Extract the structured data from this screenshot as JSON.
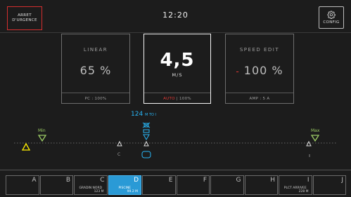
{
  "header": {
    "estop_line1": "ARRET",
    "estop_line2": "D'URGENCE",
    "clock": "12:20",
    "config_label": "CONFIG"
  },
  "cards": {
    "linear": {
      "title": "LINEAR",
      "value": "65 %",
      "footer": "PC : 100%"
    },
    "speed": {
      "value": "4,5",
      "unit": "M/S",
      "footer_mode": "AUTO",
      "footer_rest": " | 100%"
    },
    "speed_edit": {
      "title": "SPEED EDIT",
      "prefix": "-",
      "value": "100 %",
      "footer": "AMP : 5 A"
    }
  },
  "track": {
    "position_label": "124",
    "position_suffix": "M TO I",
    "min_label": "Min",
    "max_label": "Max",
    "current_marker_label": "C",
    "current_station": "D",
    "right_marker": "I"
  },
  "stations": [
    {
      "letter": "A",
      "sub": "",
      "dist": ""
    },
    {
      "letter": "B",
      "sub": "",
      "dist": ""
    },
    {
      "letter": "C",
      "sub": "GRADIN NORD",
      "dist": "123 M"
    },
    {
      "letter": "D",
      "sub": "PISCINE",
      "dist": "99.2 M"
    },
    {
      "letter": "E",
      "sub": "",
      "dist": ""
    },
    {
      "letter": "F",
      "sub": "",
      "dist": ""
    },
    {
      "letter": "G",
      "sub": "",
      "dist": ""
    },
    {
      "letter": "H",
      "sub": "",
      "dist": ""
    },
    {
      "letter": "I",
      "sub": "PLCT ARRIVEE",
      "dist": "228 M"
    },
    {
      "letter": "J",
      "sub": "",
      "dist": ""
    }
  ],
  "colors": {
    "estop_border": "#d32f2f",
    "accent_blue": "#29b6f6",
    "min_max_green": "#9ccc65",
    "warning_yellow": "#ffee00",
    "auto_red": "#e53935"
  }
}
